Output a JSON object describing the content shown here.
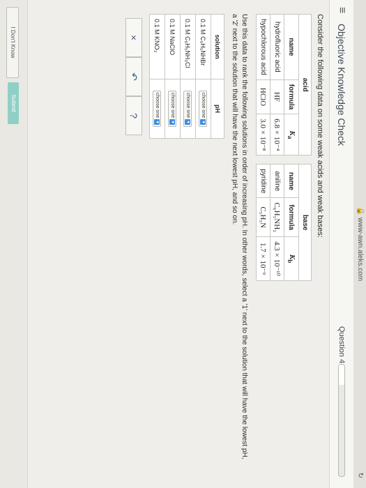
{
  "browser": {
    "url": "www-awn.aleks.com"
  },
  "header": {
    "menu_icon": "hamburger-icon",
    "title": "Objective Knowledge Check",
    "question_label": "Question 4",
    "progress_fraction": 0.18
  },
  "main": {
    "intro": "Consider the following data on some weak acids and weak bases:",
    "acid_table": {
      "group_header": "acid",
      "headers": [
        "name",
        "formula",
        "Ka"
      ],
      "rows": [
        {
          "name": "hydrofluoric acid",
          "formula": "HF",
          "k": "6.8 × 10⁻⁴"
        },
        {
          "name": "hypochlorous acid",
          "formula": "HClO",
          "k": "3.0 × 10⁻⁸"
        }
      ]
    },
    "base_table": {
      "group_header": "base",
      "headers": [
        "name",
        "formula",
        "Kb"
      ],
      "rows": [
        {
          "name": "aniline",
          "formula": "C₆H₅NH₂",
          "k": "4.3 × 10⁻¹⁰"
        },
        {
          "name": "pyridine",
          "formula": "C₅H₅N",
          "k": "1.7 × 10⁻⁹"
        }
      ]
    },
    "instruction": "Use this data to rank the following solutions in order of increasing pH. In other words, select a '1' next to the solution that will have the lowest pH, a '2' next to the solution that will have the next lowest pH, and so on.",
    "rank_table": {
      "headers": [
        "solution",
        "pH"
      ],
      "rows": [
        {
          "solution": "0.1 M C₅H₅NHBr",
          "select": "choose one"
        },
        {
          "solution": "0.1 M C₆H₅NH₃Cl",
          "select": "choose one"
        },
        {
          "solution": "0.1 M NaClO",
          "select": "choose one"
        },
        {
          "solution": "0.1 M KNO₃",
          "select": "choose one"
        }
      ]
    },
    "actions": {
      "clear": "×",
      "undo": "↶",
      "help": "?"
    }
  },
  "footer": {
    "dont_know": "I Don't Know",
    "submit": "Submit"
  }
}
